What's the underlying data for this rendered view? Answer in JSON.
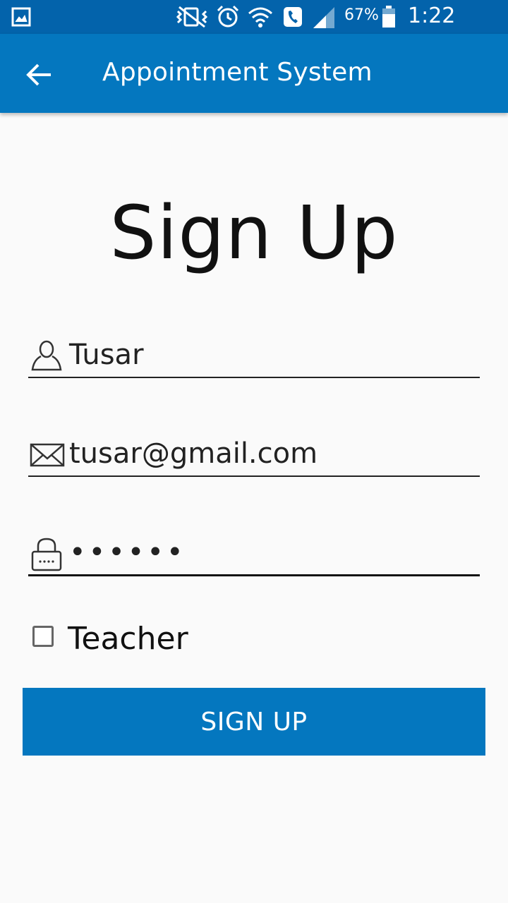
{
  "status_bar": {
    "battery_percent": "67%",
    "time": "1:22 p.m.",
    "icons": [
      "gallery-icon",
      "vibrate-mute-icon",
      "alarm-icon",
      "wifi-icon",
      "call-icon",
      "signal-icon",
      "battery-icon"
    ]
  },
  "app_bar": {
    "title": "Appointment System",
    "back_icon": "arrow-back-icon",
    "color": "#0477bf"
  },
  "main": {
    "heading": "Sign Up",
    "name_field": {
      "value": "Tusar",
      "icon": "person-icon"
    },
    "email_field": {
      "value": "tusar@gmail.com",
      "icon": "mail-icon"
    },
    "password_field": {
      "value": "••••••",
      "icon": "lock-icon"
    },
    "teacher_checkbox": {
      "label": "Teacher",
      "checked": false
    },
    "signup_button": {
      "label": "SIGN UP",
      "color": "#0477bf"
    }
  }
}
